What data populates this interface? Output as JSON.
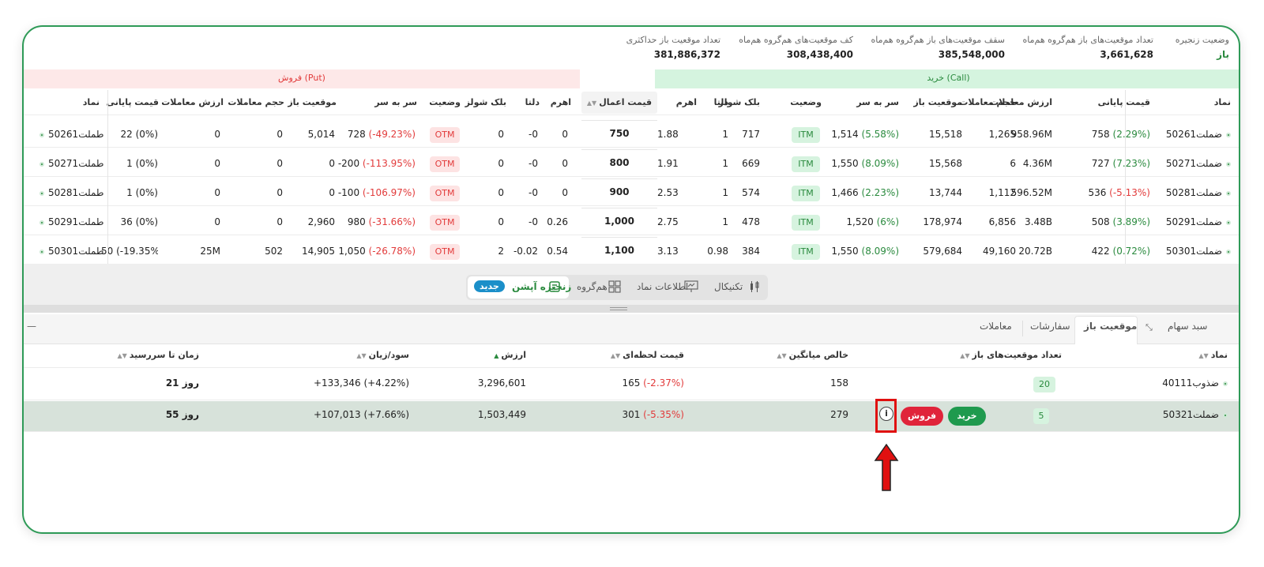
{
  "summary": [
    {
      "label": "وضعیت زنجیره",
      "value": "باز",
      "color": "green"
    },
    {
      "label": "تعداد موقعیت‌های باز هم‌گروه هم‌ماه",
      "value": "3,661,628"
    },
    {
      "label": "سقف موقعیت‌های باز هم‌گروه هم‌ماه",
      "value": "385,548,000"
    },
    {
      "label": "کف موقعیت‌های هم‌گروه هم‌ماه",
      "value": "308,438,400"
    },
    {
      "label": "تعداد موقعیت باز حداکثری",
      "value": "381,886,372"
    }
  ],
  "call_title": "خرید (Call)",
  "put_title": "فروش (Put)",
  "strike_header": "قیمت اعمال",
  "call_headers": [
    "نماد",
    "قیمت پایانی",
    "ارزش معاملات",
    "حجم معاملات",
    "موقعیت باز",
    "سر به سر",
    "وضعیت",
    "بلک شولز",
    "دلتا",
    "اهرم"
  ],
  "put_headers": [
    "اهرم",
    "دلتا",
    "بلک شولز",
    "وضعیت",
    "سر به سر",
    "موقعیت باز",
    "حجم معاملات",
    "ارزش معاملات",
    "قیمت پایانی",
    "نماد"
  ],
  "rows": [
    {
      "strike": "750",
      "call": {
        "sym": "ضملت50261",
        "last": "758",
        "last_pct": "(2.29%)",
        "last_c": "green",
        "value": "958.96M",
        "vol": "1,265",
        "oi": "15,518",
        "be": "1,514",
        "be_pct": "(5.58%)",
        "be_c": "green",
        "status": "ITM",
        "bs": "717",
        "delta": "1",
        "lev": "1.88"
      },
      "put": {
        "lev": "0",
        "delta": "-0",
        "bs": "0",
        "status": "OTM",
        "be": "728",
        "be_pct": "(-49.23%)",
        "oi": "5,014",
        "vol": "0",
        "value": "0",
        "last": "22 (0%)",
        "sym": "طملت50261"
      }
    },
    {
      "strike": "800",
      "call": {
        "sym": "ضملت50271",
        "last": "727",
        "last_pct": "(7.23%)",
        "last_c": "green",
        "value": "4.36M",
        "vol": "6",
        "oi": "15,568",
        "be": "1,550",
        "be_pct": "(8.09%)",
        "be_c": "green",
        "status": "ITM",
        "bs": "669",
        "delta": "1",
        "lev": "1.91"
      },
      "put": {
        "lev": "0",
        "delta": "-0",
        "bs": "0",
        "status": "OTM",
        "be": "-200",
        "be_pct": "(-113.95%)",
        "oi": "0",
        "vol": "0",
        "value": "0",
        "last": "1 (0%)",
        "sym": "طملت50271"
      }
    },
    {
      "strike": "900",
      "call": {
        "sym": "ضملت50281",
        "last": "536",
        "last_pct": "(-5.13%)",
        "last_c": "red",
        "value": "596.52M",
        "vol": "1,112",
        "oi": "13,744",
        "be": "1,466",
        "be_pct": "(2.23%)",
        "be_c": "green",
        "status": "ITM",
        "bs": "574",
        "delta": "1",
        "lev": "2.53"
      },
      "put": {
        "lev": "0",
        "delta": "-0",
        "bs": "0",
        "status": "OTM",
        "be": "-100",
        "be_pct": "(-106.97%)",
        "oi": "0",
        "vol": "0",
        "value": "0",
        "last": "1 (0%)",
        "sym": "طملت50281"
      }
    },
    {
      "strike": "1,000",
      "call": {
        "sym": "ضملت50291",
        "last": "508",
        "last_pct": "(3.89%)",
        "last_c": "green",
        "value": "3.48B",
        "vol": "6,856",
        "oi": "178,974",
        "be": "1,520",
        "be_pct": "(6%)",
        "be_c": "green",
        "status": "ITM",
        "bs": "478",
        "delta": "1",
        "lev": "2.75"
      },
      "put": {
        "lev": "0.26",
        "delta": "-0",
        "bs": "0",
        "status": "OTM",
        "be": "980",
        "be_pct": "(-31.66%)",
        "oi": "2,960",
        "vol": "0",
        "value": "0",
        "last": "36 (0%)",
        "sym": "طملت50291"
      }
    },
    {
      "strike": "1,100",
      "call": {
        "sym": "ضملت50301",
        "last": "422",
        "last_pct": "(0.72%)",
        "last_c": "green",
        "value": "20.72B",
        "vol": "49,160",
        "oi": "579,684",
        "be": "1,550",
        "be_pct": "(8.09%)",
        "be_c": "green",
        "status": "ITM",
        "bs": "384",
        "delta": "0.98",
        "lev": "3.13"
      },
      "put": {
        "lev": "0.54",
        "delta": "-0.02",
        "bs": "2",
        "status": "OTM",
        "be": "1,050",
        "be_pct": "(-26.78%)",
        "oi": "14,905",
        "vol": "502",
        "value": "25M",
        "last": "50 (-19.35%)",
        "sym": "طملت50301"
      }
    }
  ],
  "toolbar": {
    "technical": "تکنیکال",
    "info": "اطلاعات نماد",
    "group": "هم‌گروه",
    "chain": "زنجیره آپشن",
    "new_badge": "جدید"
  },
  "bottom_tabs": {
    "basket": "سبد سهام",
    "open_pos": "موقعیت باز",
    "orders": "سفارشات",
    "trades": "معاملات",
    "minimize": "—"
  },
  "positions": {
    "headers": [
      "نماد",
      "تعداد موقعیت‌های باز",
      "خالص میانگین",
      "قیمت لحظه‌ای",
      "ارزش",
      "سود/زیان",
      "زمان تا سررسید"
    ],
    "buy_label": "خرید",
    "sell_label": "فروش",
    "rows": [
      {
        "sym": "ضذوب40111",
        "count": "20",
        "avg": "158",
        "price": "165",
        "price_pct": "(-2.37%)",
        "value": "3,296,601",
        "pnl": "+133,346 (+4.22%)",
        "expiry": "21 روز"
      },
      {
        "sym": "ضملت50321",
        "count": "5",
        "avg": "279",
        "price": "301",
        "price_pct": "(-5.35%)",
        "value": "1,503,449",
        "pnl": "+107,013 (+7.66%)",
        "expiry": "55 روز"
      }
    ]
  }
}
